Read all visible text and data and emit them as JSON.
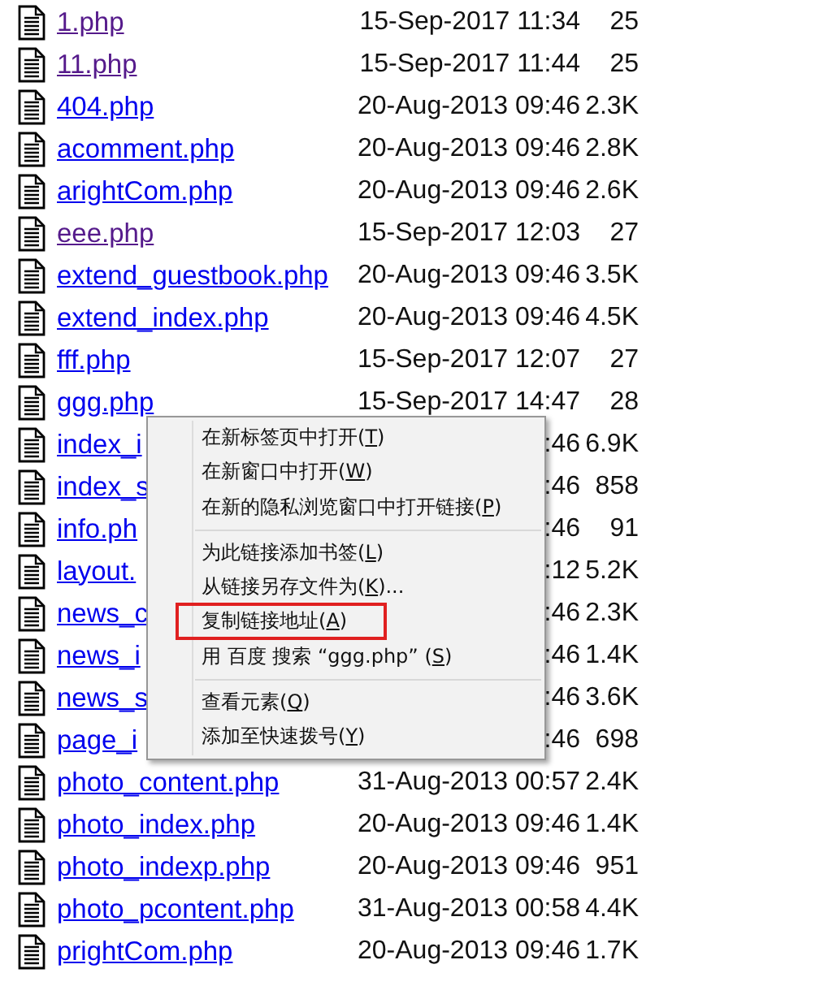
{
  "files": [
    {
      "name": "1.php",
      "visited": true,
      "date": "15-Sep-2017 11:34",
      "size": "25"
    },
    {
      "name": "11.php",
      "visited": true,
      "date": "15-Sep-2017 11:44",
      "size": "25"
    },
    {
      "name": "404.php",
      "visited": false,
      "date": "20-Aug-2013 09:46",
      "size": "2.3K"
    },
    {
      "name": "acomment.php",
      "visited": false,
      "date": "20-Aug-2013 09:46",
      "size": "2.8K"
    },
    {
      "name": "arightCom.php",
      "visited": false,
      "date": "20-Aug-2013 09:46",
      "size": "2.6K"
    },
    {
      "name": "eee.php",
      "visited": true,
      "date": "15-Sep-2017 12:03",
      "size": "27"
    },
    {
      "name": "extend_guestbook.php",
      "visited": false,
      "date": "20-Aug-2013 09:46",
      "size": "3.5K"
    },
    {
      "name": "extend_index.php",
      "visited": false,
      "date": "20-Aug-2013 09:46",
      "size": "4.5K"
    },
    {
      "name": "fff.php",
      "visited": false,
      "date": "15-Sep-2017 12:07",
      "size": "27"
    },
    {
      "name": "ggg.php",
      "visited": false,
      "date": "15-Sep-2017 14:47",
      "size": "28"
    },
    {
      "name": "index_i",
      "visited": false,
      "date": ":46",
      "size": "6.9K"
    },
    {
      "name": "index_s",
      "visited": false,
      "date": ":46",
      "size": "858"
    },
    {
      "name": "info.ph",
      "visited": false,
      "date": ":46",
      "size": "91"
    },
    {
      "name": "layout.",
      "visited": false,
      "date": ":12",
      "size": "5.2K"
    },
    {
      "name": "news_c",
      "visited": false,
      "date": ":46",
      "size": "2.3K"
    },
    {
      "name": "news_i",
      "visited": false,
      "date": ":46",
      "size": "1.4K"
    },
    {
      "name": "news_s",
      "visited": false,
      "date": ":46",
      "size": "3.6K"
    },
    {
      "name": "page_i",
      "visited": false,
      "date": ":46",
      "size": "698"
    },
    {
      "name": "photo_content.php",
      "visited": false,
      "date": "31-Aug-2013 00:57",
      "size": "2.4K"
    },
    {
      "name": "photo_index.php",
      "visited": false,
      "date": "20-Aug-2013 09:46",
      "size": "1.4K"
    },
    {
      "name": "photo_indexp.php",
      "visited": false,
      "date": "20-Aug-2013 09:46",
      "size": "951"
    },
    {
      "name": "photo_pcontent.php",
      "visited": false,
      "date": "31-Aug-2013 00:58",
      "size": "4.4K"
    },
    {
      "name": "prightCom.php",
      "visited": false,
      "date": "20-Aug-2013 09:46",
      "size": "1.7K"
    }
  ],
  "context_menu": [
    {
      "kind": "item",
      "text": "在新标签页中打开(",
      "accel": "T",
      "tail": ")",
      "marked": false
    },
    {
      "kind": "item",
      "text": "在新窗口中打开(",
      "accel": "W",
      "tail": ")",
      "marked": false
    },
    {
      "kind": "item",
      "text": "在新的隐私浏览窗口中打开链接(",
      "accel": "P",
      "tail": ")",
      "marked": false
    },
    {
      "kind": "separator"
    },
    {
      "kind": "item",
      "text": "为此链接添加书签(",
      "accel": "L",
      "tail": ")",
      "marked": false
    },
    {
      "kind": "item",
      "text": "从链接另存文件为(",
      "accel": "K",
      "tail": ")...",
      "marked": false
    },
    {
      "kind": "item",
      "text": "复制链接地址(",
      "accel": "A",
      "tail": ")",
      "marked": true
    },
    {
      "kind": "item",
      "text": "用 百度 搜索 “ggg.php” (",
      "accel": "S",
      "tail": ")",
      "marked": false
    },
    {
      "kind": "separator"
    },
    {
      "kind": "item",
      "text": "查看元素(",
      "accel": "Q",
      "tail": ")",
      "marked": false
    },
    {
      "kind": "item",
      "text": "添加至快速拨号(",
      "accel": "Y",
      "tail": ")",
      "marked": false
    }
  ]
}
